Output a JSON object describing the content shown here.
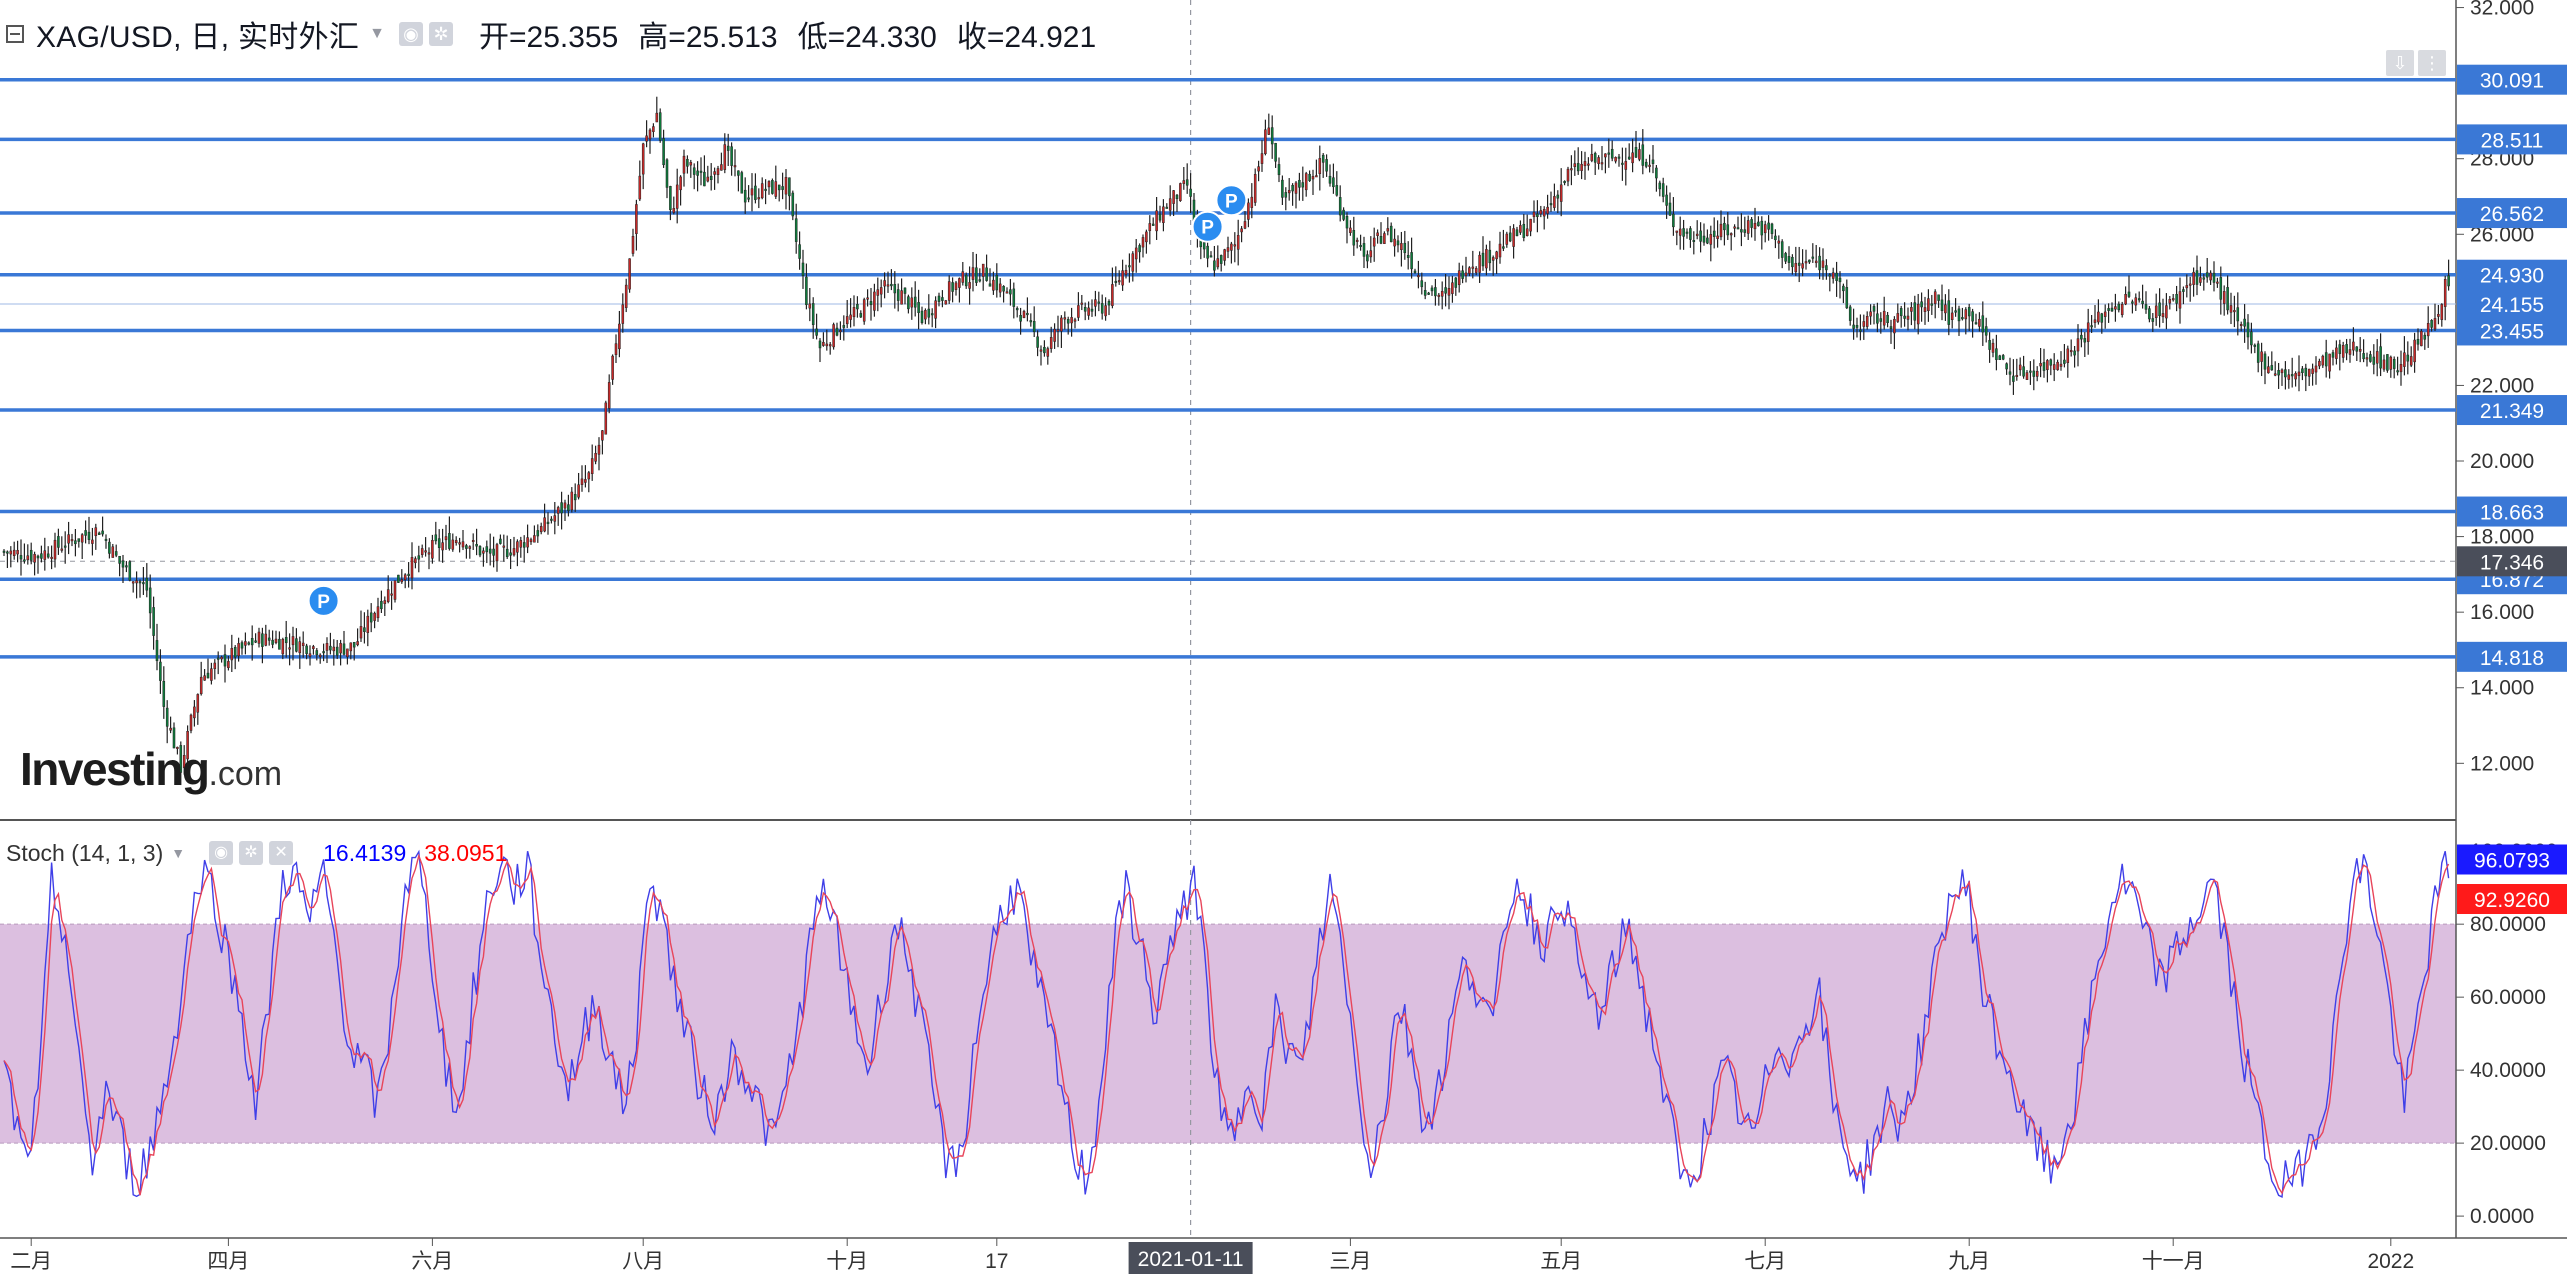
{
  "header": {
    "symbol": "XAG/USD, 日, 实时外汇",
    "open": "开=25.355",
    "high": "高=25.513",
    "low": "低=24.330",
    "close": "收=24.921"
  },
  "logo": {
    "main": "Investing",
    "suffix": ".com"
  },
  "stoch_header": {
    "name": "Stoch (14, 1, 3)",
    "k_value": "16.4139",
    "d_value": "38.0951"
  },
  "colors": {
    "up": "#c62828",
    "down": "#0e7a3b",
    "level_line": "#3a78d6",
    "level_label_bg": "#3a78d6",
    "band_fill": "#dcbfe0",
    "k_line": "#3f3fe8",
    "d_line": "#e8455a"
  },
  "price_axis": {
    "ticks": [
      12,
      14,
      16,
      18,
      20,
      22,
      26,
      28,
      32
    ],
    "tick_labels": [
      "12.000",
      "14.000",
      "16.000",
      "18.000",
      "20.000",
      "22.000",
      "26.000",
      "28.000",
      "32.000"
    ],
    "range": [
      10.5,
      32.2
    ]
  },
  "levels": [
    {
      "value": 30.091,
      "label": "30.091"
    },
    {
      "value": 28.511,
      "label": "28.511"
    },
    {
      "value": 26.562,
      "label": "26.562"
    },
    {
      "value": 24.93,
      "label": "24.930"
    },
    {
      "value": 23.455,
      "label": "23.455"
    },
    {
      "value": 21.349,
      "label": "21.349"
    },
    {
      "value": 18.663,
      "label": "18.663"
    },
    {
      "value": 16.872,
      "label": "16.872"
    },
    {
      "value": 14.818,
      "label": "14.818"
    }
  ],
  "current_price": {
    "value": 24.155,
    "label": "24.155"
  },
  "crosshair": {
    "price": 17.346,
    "label": "17.346",
    "date_label": "2021-01-11"
  },
  "markers": [
    {
      "date_index": 94,
      "price": 16.3,
      "label": "P"
    },
    {
      "date_index": 354,
      "price": 26.2,
      "label": "P"
    },
    {
      "date_index": 361,
      "price": 26.9,
      "label": "P"
    }
  ],
  "time_axis": [
    {
      "label": "二月",
      "index": 8
    },
    {
      "label": "四月",
      "index": 66
    },
    {
      "label": "六月",
      "index": 126
    },
    {
      "label": "八月",
      "index": 188
    },
    {
      "label": "十月",
      "index": 248
    },
    {
      "label": "17",
      "index": 292
    },
    {
      "label": "三月",
      "index": 396
    },
    {
      "label": "五月",
      "index": 458
    },
    {
      "label": "七月",
      "index": 518
    },
    {
      "label": "九月",
      "index": 578
    },
    {
      "label": "十一月",
      "index": 638
    },
    {
      "label": "2022",
      "index": 702
    }
  ],
  "stoch_axis": {
    "ticks": [
      0,
      20,
      40,
      60,
      80
    ],
    "tick_labels": [
      "0.0000",
      "20.0000",
      "40.0000",
      "60.0000",
      "80.0000"
    ],
    "top_partial": "100.0000",
    "band": [
      20,
      80
    ],
    "range": [
      -6,
      108
    ],
    "k_last": {
      "value": 96.0793,
      "label": "96.0793"
    },
    "d_last": {
      "value": 92.926,
      "label": "92.9260"
    }
  },
  "chart_data": {
    "type": "candlestick",
    "title": "XAG/USD, 日, 实时外汇",
    "x_range_labels": [
      "二月",
      "2022"
    ],
    "ylim": [
      10.5,
      32.2
    ],
    "close_path_anchors": [
      [
        0,
        17.6
      ],
      [
        10,
        17.5
      ],
      [
        20,
        17.9
      ],
      [
        28,
        18.2
      ],
      [
        34,
        17.3
      ],
      [
        42,
        16.6
      ],
      [
        47,
        13.5
      ],
      [
        52,
        11.9
      ],
      [
        58,
        14.3
      ],
      [
        66,
        14.8
      ],
      [
        75,
        15.3
      ],
      [
        85,
        15.2
      ],
      [
        95,
        15.0
      ],
      [
        103,
        15.1
      ],
      [
        110,
        16.2
      ],
      [
        118,
        17.1
      ],
      [
        126,
        17.7
      ],
      [
        134,
        18.0
      ],
      [
        142,
        17.5
      ],
      [
        150,
        17.7
      ],
      [
        158,
        18.2
      ],
      [
        166,
        18.9
      ],
      [
        172,
        19.6
      ],
      [
        176,
        20.7
      ],
      [
        180,
        23.2
      ],
      [
        184,
        25.3
      ],
      [
        188,
        28.3
      ],
      [
        192,
        29.2
      ],
      [
        196,
        26.5
      ],
      [
        200,
        27.9
      ],
      [
        206,
        27.4
      ],
      [
        212,
        28.2
      ],
      [
        218,
        27.0
      ],
      [
        224,
        27.2
      ],
      [
        230,
        27.3
      ],
      [
        236,
        24.3
      ],
      [
        240,
        23.0
      ],
      [
        246,
        23.6
      ],
      [
        252,
        24.0
      ],
      [
        258,
        24.6
      ],
      [
        264,
        24.4
      ],
      [
        270,
        23.8
      ],
      [
        276,
        24.4
      ],
      [
        282,
        24.8
      ],
      [
        288,
        25.0
      ],
      [
        294,
        24.5
      ],
      [
        300,
        23.8
      ],
      [
        306,
        22.9
      ],
      [
        312,
        23.8
      ],
      [
        318,
        24.0
      ],
      [
        324,
        24.1
      ],
      [
        330,
        25.2
      ],
      [
        336,
        26.0
      ],
      [
        342,
        26.8
      ],
      [
        348,
        27.3
      ],
      [
        352,
        25.5
      ],
      [
        356,
        25.2
      ],
      [
        362,
        25.7
      ],
      [
        368,
        27.4
      ],
      [
        372,
        29.0
      ],
      [
        376,
        26.8
      ],
      [
        382,
        27.4
      ],
      [
        388,
        27.9
      ],
      [
        394,
        26.5
      ],
      [
        400,
        25.3
      ],
      [
        406,
        26.1
      ],
      [
        412,
        25.6
      ],
      [
        418,
        24.6
      ],
      [
        424,
        24.3
      ],
      [
        430,
        25.2
      ],
      [
        436,
        25.4
      ],
      [
        442,
        25.8
      ],
      [
        448,
        26.2
      ],
      [
        454,
        26.7
      ],
      [
        460,
        27.6
      ],
      [
        466,
        27.9
      ],
      [
        472,
        28.0
      ],
      [
        478,
        28.1
      ],
      [
        484,
        28.0
      ],
      [
        490,
        26.4
      ],
      [
        496,
        25.9
      ],
      [
        502,
        26.0
      ],
      [
        508,
        26.1
      ],
      [
        514,
        26.3
      ],
      [
        520,
        26.0
      ],
      [
        526,
        25.1
      ],
      [
        532,
        25.3
      ],
      [
        538,
        25.1
      ],
      [
        544,
        23.5
      ],
      [
        550,
        23.8
      ],
      [
        556,
        23.7
      ],
      [
        562,
        23.9
      ],
      [
        568,
        24.4
      ],
      [
        572,
        23.8
      ],
      [
        578,
        24.0
      ],
      [
        584,
        23.1
      ],
      [
        590,
        22.3
      ],
      [
        596,
        22.4
      ],
      [
        602,
        22.6
      ],
      [
        608,
        22.9
      ],
      [
        614,
        23.6
      ],
      [
        620,
        24.1
      ],
      [
        626,
        24.3
      ],
      [
        632,
        23.9
      ],
      [
        638,
        24.2
      ],
      [
        644,
        24.9
      ],
      [
        650,
        24.8
      ],
      [
        656,
        23.8
      ],
      [
        662,
        22.9
      ],
      [
        668,
        22.4
      ],
      [
        674,
        22.2
      ],
      [
        680,
        22.5
      ],
      [
        686,
        22.8
      ],
      [
        692,
        23.0
      ],
      [
        698,
        22.7
      ],
      [
        704,
        22.5
      ],
      [
        710,
        23.1
      ],
      [
        714,
        23.6
      ],
      [
        718,
        24.6
      ]
    ],
    "k_path_anchors": [
      [
        0,
        40
      ],
      [
        6,
        15
      ],
      [
        10,
        30
      ],
      [
        14,
        90
      ],
      [
        18,
        78
      ],
      [
        22,
        40
      ],
      [
        26,
        15
      ],
      [
        30,
        35
      ],
      [
        34,
        22
      ],
      [
        38,
        10
      ],
      [
        42,
        15
      ],
      [
        46,
        30
      ],
      [
        50,
        48
      ],
      [
        54,
        75
      ],
      [
        58,
        95
      ],
      [
        62,
        88
      ],
      [
        66,
        70
      ],
      [
        70,
        55
      ],
      [
        74,
        30
      ],
      [
        78,
        60
      ],
      [
        82,
        94
      ],
      [
        86,
        92
      ],
      [
        90,
        80
      ],
      [
        94,
        94
      ],
      [
        98,
        70
      ],
      [
        102,
        45
      ],
      [
        106,
        40
      ],
      [
        110,
        30
      ],
      [
        114,
        55
      ],
      [
        118,
        92
      ],
      [
        122,
        96
      ],
      [
        126,
        70
      ],
      [
        130,
        40
      ],
      [
        134,
        30
      ],
      [
        138,
        60
      ],
      [
        142,
        85
      ],
      [
        146,
        98
      ],
      [
        150,
        90
      ],
      [
        154,
        96
      ],
      [
        158,
        70
      ],
      [
        162,
        50
      ],
      [
        166,
        35
      ],
      [
        170,
        48
      ],
      [
        174,
        60
      ],
      [
        178,
        45
      ],
      [
        182,
        30
      ],
      [
        186,
        50
      ],
      [
        190,
        95
      ],
      [
        194,
        80
      ],
      [
        198,
        60
      ],
      [
        202,
        45
      ],
      [
        206,
        32
      ],
      [
        210,
        28
      ],
      [
        214,
        45
      ],
      [
        218,
        40
      ],
      [
        222,
        30
      ],
      [
        226,
        20
      ],
      [
        230,
        35
      ],
      [
        234,
        55
      ],
      [
        238,
        80
      ],
      [
        242,
        90
      ],
      [
        246,
        70
      ],
      [
        250,
        55
      ],
      [
        254,
        40
      ],
      [
        258,
        60
      ],
      [
        262,
        80
      ],
      [
        266,
        72
      ],
      [
        270,
        50
      ],
      [
        274,
        30
      ],
      [
        278,
        12
      ],
      [
        282,
        20
      ],
      [
        286,
        50
      ],
      [
        290,
        72
      ],
      [
        294,
        85
      ],
      [
        298,
        90
      ],
      [
        302,
        70
      ],
      [
        306,
        55
      ],
      [
        310,
        40
      ],
      [
        314,
        20
      ],
      [
        318,
        10
      ],
      [
        322,
        30
      ],
      [
        326,
        70
      ],
      [
        330,
        90
      ],
      [
        334,
        75
      ],
      [
        338,
        55
      ],
      [
        342,
        70
      ],
      [
        346,
        80
      ],
      [
        350,
        95
      ],
      [
        354,
        60
      ],
      [
        358,
        25
      ],
      [
        362,
        20
      ],
      [
        366,
        40
      ],
      [
        370,
        30
      ],
      [
        374,
        55
      ],
      [
        378,
        45
      ],
      [
        382,
        40
      ],
      [
        386,
        70
      ],
      [
        390,
        90
      ],
      [
        394,
        72
      ],
      [
        398,
        35
      ],
      [
        402,
        15
      ],
      [
        406,
        30
      ],
      [
        410,
        60
      ],
      [
        414,
        45
      ],
      [
        418,
        25
      ],
      [
        422,
        35
      ],
      [
        426,
        55
      ],
      [
        430,
        70
      ],
      [
        434,
        62
      ],
      [
        438,
        50
      ],
      [
        442,
        85
      ],
      [
        446,
        92
      ],
      [
        450,
        80
      ],
      [
        454,
        75
      ],
      [
        458,
        90
      ],
      [
        462,
        72
      ],
      [
        466,
        60
      ],
      [
        470,
        55
      ],
      [
        474,
        70
      ],
      [
        478,
        80
      ],
      [
        482,
        60
      ],
      [
        486,
        45
      ],
      [
        490,
        25
      ],
      [
        494,
        8
      ],
      [
        498,
        15
      ],
      [
        502,
        28
      ],
      [
        506,
        40
      ],
      [
        510,
        30
      ],
      [
        514,
        20
      ],
      [
        518,
        35
      ],
      [
        522,
        50
      ],
      [
        526,
        42
      ],
      [
        530,
        55
      ],
      [
        534,
        60
      ],
      [
        538,
        30
      ],
      [
        542,
        18
      ],
      [
        546,
        10
      ],
      [
        550,
        20
      ],
      [
        554,
        30
      ],
      [
        558,
        25
      ],
      [
        562,
        40
      ],
      [
        566,
        55
      ],
      [
        570,
        80
      ],
      [
        574,
        90
      ],
      [
        578,
        88
      ],
      [
        582,
        62
      ],
      [
        586,
        48
      ],
      [
        590,
        40
      ],
      [
        594,
        25
      ],
      [
        598,
        20
      ],
      [
        602,
        12
      ],
      [
        606,
        22
      ],
      [
        610,
        35
      ],
      [
        614,
        60
      ],
      [
        618,
        78
      ],
      [
        622,
        92
      ],
      [
        626,
        88
      ],
      [
        630,
        75
      ],
      [
        634,
        65
      ],
      [
        638,
        70
      ],
      [
        642,
        78
      ],
      [
        646,
        85
      ],
      [
        650,
        92
      ],
      [
        654,
        70
      ],
      [
        658,
        48
      ],
      [
        662,
        30
      ],
      [
        666,
        15
      ],
      [
        670,
        8
      ],
      [
        674,
        10
      ],
      [
        678,
        20
      ],
      [
        682,
        30
      ],
      [
        686,
        55
      ],
      [
        690,
        90
      ],
      [
        694,
        96
      ],
      [
        698,
        80
      ],
      [
        702,
        55
      ],
      [
        706,
        30
      ],
      [
        710,
        55
      ],
      [
        714,
        80
      ],
      [
        718,
        96
      ]
    ]
  }
}
